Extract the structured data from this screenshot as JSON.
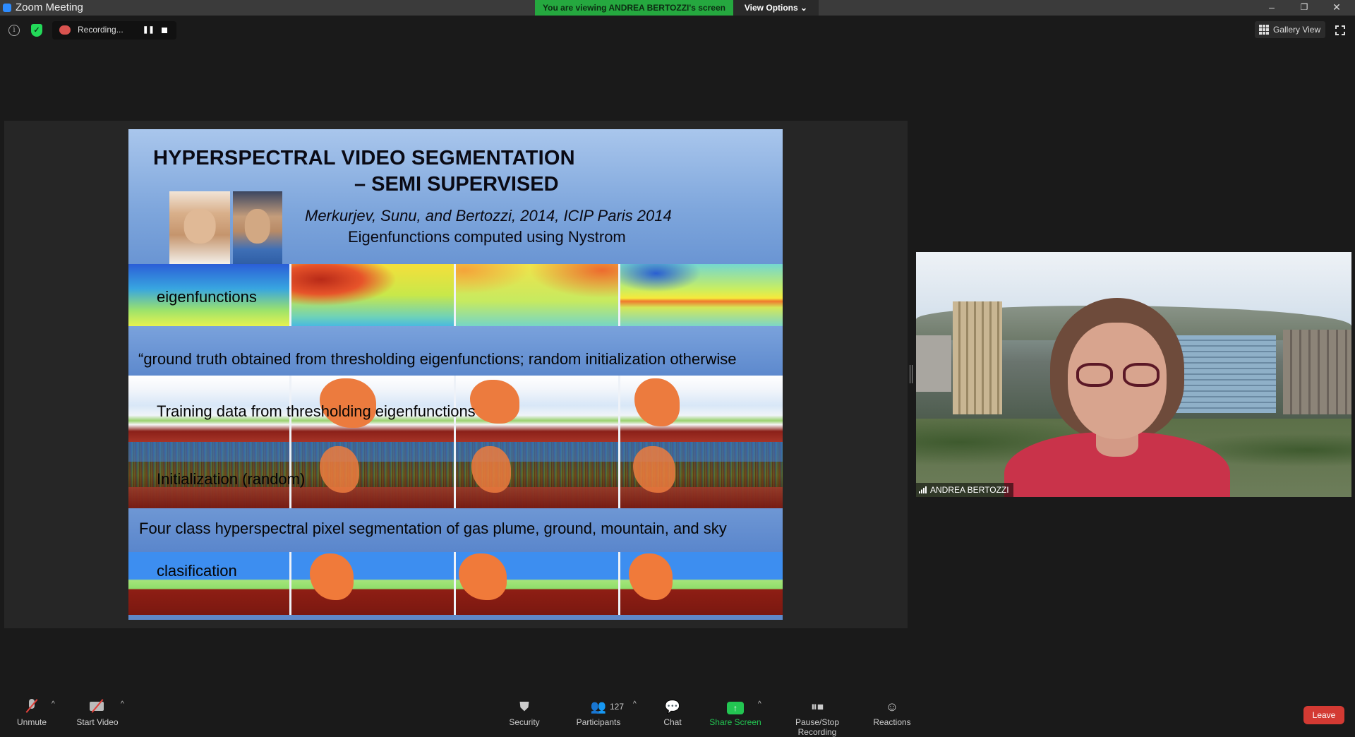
{
  "window": {
    "title": "Zoom Meeting",
    "sharing_banner": "You are viewing ANDREA BERTOZZI's screen",
    "view_options": "View Options",
    "chevron": "⌄",
    "minimize": "–",
    "restore": "❐",
    "close": "✕"
  },
  "topbar": {
    "info_icon": "i",
    "recording_label": "Recording...",
    "pause_glyph": "❚❚",
    "gallery_view": "Gallery View"
  },
  "slide": {
    "title_line1": "HYPERSPECTRAL VIDEO SEGMENTATION",
    "title_line2": "– SEMI SUPERVISED",
    "citation": "Merkurjev, Sunu, and Bertozzi, 2014, ICIP Paris 2014",
    "subline": "Eigenfunctions computed using Nystrom",
    "row_eigen": "eigenfunctions",
    "band1": "“ground truth obtained from thresholding eigenfunctions; random initialization otherwise",
    "row_training": "Training data from thresholding eigenfunctions",
    "row_init": "Initialization (random)",
    "band2": "Four class hyperspectral pixel segmentation of gas plume, ground, mountain, and sky",
    "row_class": "clasification"
  },
  "video": {
    "participant_name": "ANDREA BERTOZZI"
  },
  "toolbar": {
    "unmute": "Unmute",
    "start_video": "Start Video",
    "security": "Security",
    "participants": "Participants",
    "participant_count": "127",
    "chat": "Chat",
    "share_screen": "Share Screen",
    "pause_stop_recording": "Pause/Stop Recording",
    "reactions": "Reactions",
    "leave": "Leave",
    "caret": "^",
    "share_arrow": "↑"
  },
  "colors": {
    "share_banner": "#25a83f",
    "leave": "#d33a33",
    "share_screen_accent": "#23c552"
  }
}
